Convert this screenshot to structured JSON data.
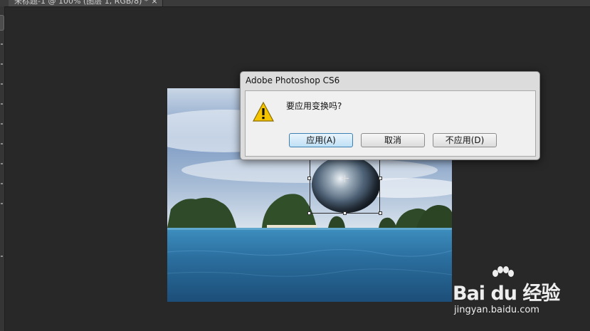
{
  "document_tab": {
    "title": "未标题-1 @ 100% (图层 1, RGB/8) *",
    "close_glyph": "×"
  },
  "toolbox": {
    "icon": "tool-strip"
  },
  "canvas": {
    "layer_icon": "seascape-image",
    "transform_object": "sphere"
  },
  "dialog": {
    "title": "Adobe Photoshop CS6",
    "icon": "warning-icon",
    "message": "要应用变换吗?",
    "buttons": {
      "apply": "应用(A)",
      "cancel": "取消",
      "dont_apply": "不应用(D)"
    }
  },
  "watermark": {
    "logo_text": "Bai du 经验",
    "url": "jingyan.baidu.com"
  },
  "colors": {
    "workspace_bg": "#282828",
    "dialog_bg": "#dcdcdc",
    "default_button_border": "#3c7fb1"
  }
}
